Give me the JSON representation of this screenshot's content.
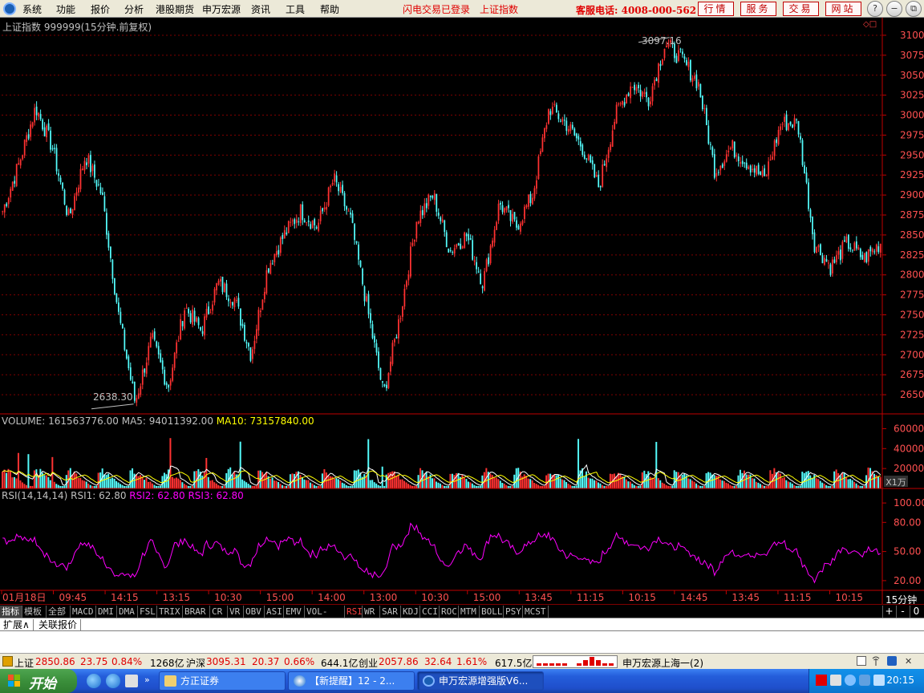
{
  "menubar": {
    "items": [
      "系统",
      "功能",
      "报价",
      "分析",
      "港股期货",
      "申万宏源",
      "资讯",
      "工具",
      "帮助"
    ],
    "status_login": "闪电交易已登录",
    "status_index": "上证指数",
    "hotline": "客服电话: 4008-000-562",
    "tabs": [
      "行情",
      "服务",
      "交易",
      "网站"
    ],
    "window_buttons": [
      "?",
      "−",
      "⧉",
      "✕"
    ]
  },
  "chart": {
    "title": "上证指数 999999(15分钟.前复权)",
    "high_label": "3097.16",
    "low_label": "2638.30",
    "price_ticks": [
      "3100",
      "3075",
      "3050",
      "3025",
      "3000",
      "2975",
      "2950",
      "2925",
      "2900",
      "2875",
      "2850",
      "2825",
      "2800",
      "2775",
      "2750",
      "2725",
      "2700",
      "2675",
      "2650"
    ],
    "volume_header": {
      "volume": "VOLUME: 161563776.00",
      "ma5": "MA5: 94011392.00",
      "ma10": "MA10: 73157840.00"
    },
    "volume_ticks": [
      "60000",
      "40000",
      "20000"
    ],
    "volume_unit": "X1万",
    "rsi_header": {
      "name": "RSI(14,14,14)",
      "rsi1": "RSI1: 62.80",
      "rsi2": "RSI2: 62.80",
      "rsi3": "RSI3: 62.80"
    },
    "rsi_ticks": [
      "100.00",
      "80.00",
      "50.00",
      "20.00"
    ],
    "time_labels": [
      "01月18日",
      "09:45",
      "14:15",
      "13:15",
      "10:30",
      "15:00",
      "14:00",
      "13:00",
      "10:30",
      "15:00",
      "13:45",
      "11:15",
      "10:15",
      "14:45",
      "13:45",
      "11:15",
      "10:15"
    ],
    "period": "15分钟",
    "colors": {
      "up": "#ff3232",
      "down": "#54fcfc",
      "ma5": "#ffff00",
      "rsi": "#ff00ff",
      "grid": "#800000"
    }
  },
  "chart_data": {
    "type": "candlestick",
    "title": "上证指数 999999(15分钟.前复权)",
    "price_range": [
      2625,
      3110
    ],
    "annotated_high": 3097.16,
    "annotated_low": 2638.3,
    "price_trace": [
      2880,
      2940,
      3010,
      2960,
      2870,
      2950,
      2900,
      2750,
      2640,
      2720,
      2660,
      2760,
      2730,
      2790,
      2770,
      2700,
      2810,
      2850,
      2880,
      2860,
      2920,
      2870,
      2760,
      2650,
      2750,
      2870,
      2900,
      2830,
      2850,
      2790,
      2890,
      2860,
      2900,
      3010,
      2990,
      2960,
      2910,
      3000,
      3040,
      3020,
      3090,
      3070,
      3040,
      2930,
      2960,
      2940,
      2920,
      2990,
      2990,
      2840,
      2810,
      2840,
      2820,
      2840
    ],
    "volume_range": [
      0,
      70000
    ],
    "volume_unit": "X1万",
    "volume_last": 161563776.0,
    "ma5_last": 94011392.0,
    "ma10_last": 73157840.0,
    "rsi_range": [
      10,
      110
    ],
    "rsi_last": {
      "RSI1": 62.8,
      "RSI2": 62.8,
      "RSI3": 62.8
    },
    "x_labels": [
      "01月18日",
      "09:45",
      "14:15",
      "13:15",
      "10:30",
      "15:00",
      "14:00",
      "13:00",
      "10:30",
      "15:00",
      "13:45",
      "11:15",
      "10:15",
      "14:45",
      "13:45",
      "11:15",
      "10:15"
    ]
  },
  "indicators": {
    "tabs": [
      "指标",
      "模板",
      "全部",
      "MACD",
      "DMI",
      "DMA",
      "FSL",
      "TRIX",
      "BRAR",
      "CR",
      "VR",
      "OBV",
      "ASI",
      "EMV",
      "VOL-TDX",
      "RSI",
      "WR",
      "SAR",
      "KDJ",
      "CCI",
      "ROC",
      "MTM",
      "BOLL",
      "PSY",
      "MCST"
    ],
    "active": "RSI",
    "controls": [
      "+",
      "-",
      "0"
    ]
  },
  "subtabs": [
    "扩展∧",
    "关联报价"
  ],
  "statusbar": {
    "sh_name": "上证",
    "sh_price": "2850.86",
    "sh_change": "23.75",
    "sh_pct": "0.84%",
    "sh_amount": "1268亿",
    "hs_name": "沪深",
    "hs_price": "3095.31",
    "hs_change": "20.37",
    "hs_pct": "0.66%",
    "hs_amount": "644.1亿",
    "cy_name": "创业",
    "cy_price": "2057.86",
    "cy_change": "32.64",
    "cy_pct": "1.61%",
    "cy_amount": "617.5亿",
    "broker": "申万宏源上海一(2)"
  },
  "taskbar": {
    "start": "开始",
    "windows": [
      "方正证券",
      "【新提醒】12 - 2...",
      "申万宏源增强版V6..."
    ],
    "clock": "20:15"
  }
}
